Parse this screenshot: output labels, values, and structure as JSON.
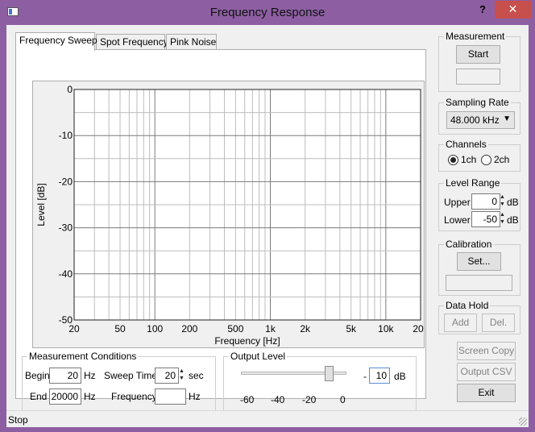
{
  "window": {
    "title": "Frequency Response",
    "help_label": "?",
    "close_label": "✕"
  },
  "tabs": [
    {
      "label": "Frequency Sweep",
      "active": true
    },
    {
      "label": "Spot Frequency",
      "active": false
    },
    {
      "label": "Pink Noise",
      "active": false
    }
  ],
  "chart_data": {
    "type": "line",
    "xlabel": "Frequency [Hz]",
    "ylabel": "Level [dB]",
    "x_scale": "log",
    "xlim": [
      20,
      20000
    ],
    "ylim": [
      -50,
      0
    ],
    "x_ticks": [
      20,
      50,
      100,
      200,
      500,
      1000,
      2000,
      5000,
      10000,
      20000
    ],
    "x_tick_labels": [
      "20",
      "50",
      "100",
      "200",
      "500",
      "1k",
      "2k",
      "5k",
      "10k",
      "20k"
    ],
    "y_ticks": [
      0,
      -10,
      -20,
      -30,
      -40,
      -50
    ],
    "y_tick_labels": [
      "0",
      "-10",
      "-20",
      "-30",
      "-40",
      "-50"
    ],
    "grid": true,
    "series": []
  },
  "conditions": {
    "title": "Measurement Conditions",
    "begin_label": "Begin",
    "begin_value": "20",
    "begin_unit": "Hz",
    "end_label": "End",
    "end_value": "20000",
    "end_unit": "Hz",
    "sweep_label": "Sweep Time",
    "sweep_value": "20",
    "sweep_unit": "sec",
    "freq_label": "Frequency",
    "freq_value": "",
    "freq_unit": "Hz"
  },
  "output_level": {
    "title": "Output Level",
    "scale_labels": [
      "-60",
      "-40",
      "-20",
      "0"
    ],
    "range": [
      -60,
      0
    ],
    "slider_value": -10,
    "value_prefix": "-",
    "value": "10",
    "unit": "dB"
  },
  "measurement": {
    "title": "Measurement",
    "start_label": "Start",
    "status": ""
  },
  "sampling": {
    "title": "Sampling Rate",
    "selected": "48.000 kHz"
  },
  "channels": {
    "title": "Channels",
    "opt1": "1ch",
    "opt2": "2ch",
    "selected": "1ch"
  },
  "level_range": {
    "title": "Level Range",
    "upper_label": "Upper",
    "upper_value": "0",
    "upper_unit": "dB",
    "lower_label": "Lower",
    "lower_value": "-50",
    "lower_unit": "dB"
  },
  "calibration": {
    "title": "Calibration",
    "set_label": "Set...",
    "status": ""
  },
  "data_hold": {
    "title": "Data Hold",
    "add_label": "Add",
    "del_label": "Del."
  },
  "buttons": {
    "screen_copy": "Screen Copy",
    "output_csv": "Output CSV",
    "exit": "Exit"
  },
  "status": {
    "text": "Stop"
  }
}
